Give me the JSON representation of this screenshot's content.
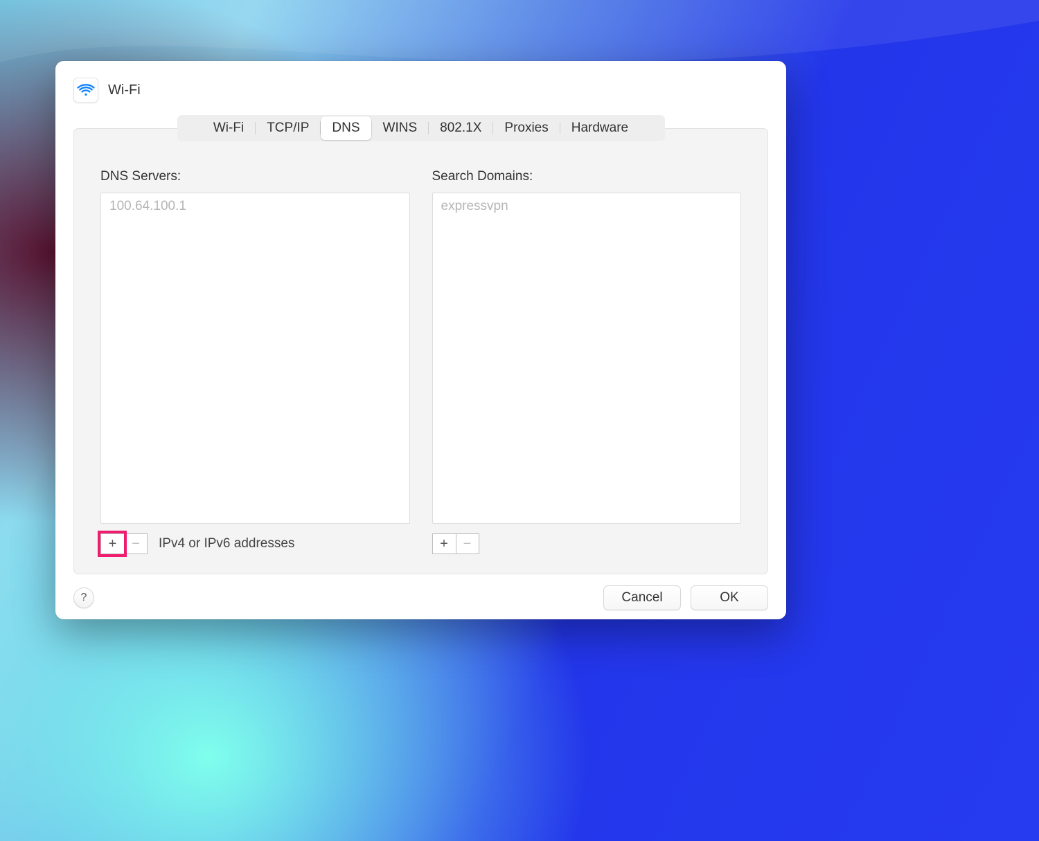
{
  "title": "Wi-Fi",
  "tabs": [
    {
      "label": "Wi-Fi"
    },
    {
      "label": "TCP/IP"
    },
    {
      "label": "DNS"
    },
    {
      "label": "WINS"
    },
    {
      "label": "802.1X"
    },
    {
      "label": "Proxies"
    },
    {
      "label": "Hardware"
    }
  ],
  "active_tab_index": 2,
  "dns": {
    "label": "DNS Servers:",
    "entries": [
      "100.64.100.1"
    ],
    "hint": "IPv4 or IPv6 addresses",
    "add_highlighted": true
  },
  "search_domains": {
    "label": "Search Domains:",
    "entries": [
      "expressvpn"
    ]
  },
  "buttons": {
    "help": "?",
    "cancel": "Cancel",
    "ok": "OK",
    "add": "+",
    "remove": "−"
  }
}
